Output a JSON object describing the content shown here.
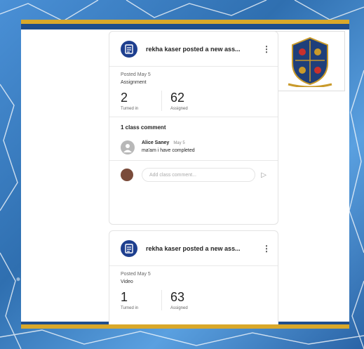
{
  "posts": [
    {
      "title": "rekha kaser posted a new ass...",
      "posted": "Posted May 5",
      "type": "Assignment",
      "stats": [
        {
          "num": "2",
          "label": "Turned in"
        },
        {
          "num": "62",
          "label": "Assigned"
        }
      ],
      "comments_title": "1 class comment",
      "comment": {
        "author": "Alice Saney",
        "date": "May 5",
        "text": "ma'am i have completed"
      },
      "reply_placeholder": "Add class comment..."
    },
    {
      "title": "rekha kaser posted a new ass...",
      "posted": "Posted May 5",
      "type": "Video",
      "stats": [
        {
          "num": "1",
          "label": "Turned in"
        },
        {
          "num": "63",
          "label": "Assigned"
        }
      ]
    }
  ],
  "colors": {
    "accent": "#1e3f8f",
    "gold": "#d9a82a",
    "frame": "#3a7fc4"
  },
  "icons": {
    "post": "assignment-icon",
    "menu": "more-vert-icon",
    "send": "send-icon",
    "emblem": "school-crest-icon"
  }
}
